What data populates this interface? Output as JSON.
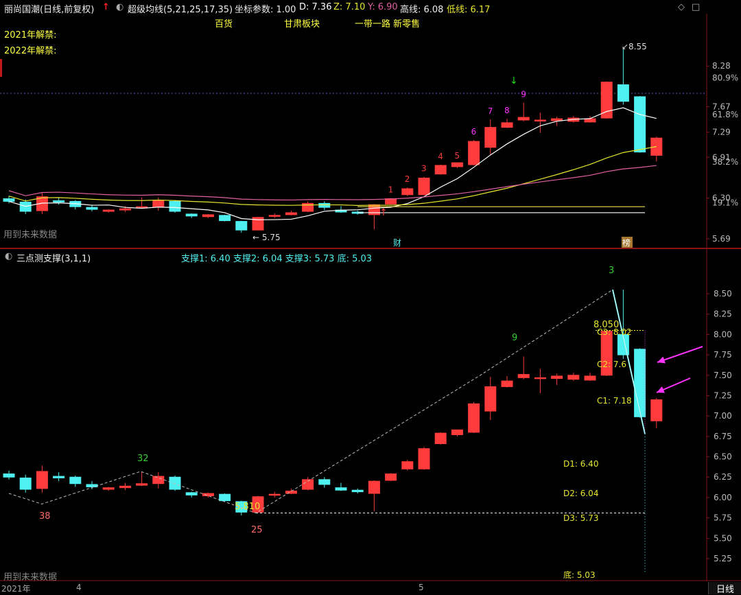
{
  "header": {
    "stock_title": "丽尚国潮(日线,前复权)",
    "up_arrow_icon": "red-up-arrow",
    "indicator_name": "超级均线(5,21,25,17,35)",
    "coord_param_label": "坐标参数: 1.00",
    "d_label": "D: 7.36",
    "z_label": "Z: 7.10",
    "y_label": "Y: 6.90",
    "high_line_label": "高线: 6.08",
    "low_line_label": "低线: 6.17",
    "concept_tags": [
      "百货",
      "甘肃板块",
      "一带一路 新零售"
    ],
    "unlock_labels": [
      "2021年解禁:",
      "2022年解禁:"
    ],
    "future_data_label": "用到未来数据"
  },
  "top_axis": {
    "ticks": [
      "8.28",
      "7.67",
      "7.29",
      "6.91",
      "6.30",
      "5.69"
    ],
    "pct": [
      "80.9%",
      "61.8%",
      "38.2%",
      "19.1%"
    ]
  },
  "top_annotations": {
    "max_label": "8.55",
    "min_label": "5.75",
    "markers_cai": "财",
    "markers_bang": "榜",
    "seq_numbers": [
      "1",
      "2",
      "3",
      "4",
      "5",
      "6",
      "7",
      "8",
      "9"
    ]
  },
  "bottom_header": {
    "indicator_name": "三点测支撑(3,1,1)",
    "support_text": "支撑1: 6.40  支撑2: 6.04  支撑3: 5.73  底: 5.03",
    "future_data_label": "用到未来数据"
  },
  "bottom_axis": {
    "ticks": [
      "8.50",
      "8.25",
      "8.00",
      "7.75",
      "7.50",
      "7.25",
      "7.00",
      "6.75",
      "6.50",
      "6.25",
      "6.00",
      "5.75",
      "5.50",
      "5.25"
    ]
  },
  "bottom_annotations": {
    "label_32": "32",
    "label_38": "38",
    "label_25": "25",
    "label_9": "9",
    "label_3": "3",
    "low_value": "5.810",
    "peak_value": "8.050",
    "c3": "C3: 8.02",
    "c2": "C2: 7.6",
    "c1": "C1: 7.18",
    "d1": "D1: 6.40",
    "d2": "D2: 6.04",
    "d3": "D3: 5.73",
    "bottom": "底: 5.03"
  },
  "footer": {
    "dates": [
      "2021年",
      "4",
      "5"
    ],
    "period_button": "日线"
  },
  "colors": {
    "up": "#ff3b3b",
    "down": "#4ff0f0",
    "ma_white": "#ffffff",
    "ma_yellow": "#e6e62e",
    "ma_pink": "#e060a0",
    "label_yellow": "#ffff40",
    "arrow_magenta": "#ff33ff"
  },
  "chart_data": {
    "type": "candlestick",
    "y_range_top": [
      5.55,
      8.72
    ],
    "y_range_bottom": [
      5.05,
      8.72
    ],
    "candles": [
      {
        "o": 6.29,
        "h": 6.33,
        "l": 6.22,
        "c": 6.25
      },
      {
        "o": 6.24,
        "h": 6.28,
        "l": 6.06,
        "c": 6.1
      },
      {
        "o": 6.11,
        "h": 6.39,
        "l": 6.06,
        "c": 6.32
      },
      {
        "o": 6.26,
        "h": 6.31,
        "l": 6.2,
        "c": 6.24
      },
      {
        "o": 6.25,
        "h": 6.27,
        "l": 6.13,
        "c": 6.17
      },
      {
        "o": 6.16,
        "h": 6.2,
        "l": 6.1,
        "c": 6.13
      },
      {
        "o": 6.1,
        "h": 6.13,
        "l": 6.08,
        "c": 6.12
      },
      {
        "o": 6.12,
        "h": 6.18,
        "l": 6.09,
        "c": 6.14
      },
      {
        "o": 6.15,
        "h": 6.31,
        "l": 6.14,
        "c": 6.17
      },
      {
        "o": 6.17,
        "h": 6.31,
        "l": 6.11,
        "c": 6.26
      },
      {
        "o": 6.25,
        "h": 6.27,
        "l": 6.08,
        "c": 6.1
      },
      {
        "o": 6.06,
        "h": 6.07,
        "l": 6.0,
        "c": 6.03
      },
      {
        "o": 6.02,
        "h": 6.06,
        "l": 6.0,
        "c": 6.05
      },
      {
        "o": 6.04,
        "h": 6.05,
        "l": 5.95,
        "c": 5.96
      },
      {
        "o": 5.95,
        "h": 5.96,
        "l": 5.78,
        "c": 5.82
      },
      {
        "o": 5.82,
        "h": 6.02,
        "l": 5.81,
        "c": 6.01
      },
      {
        "o": 6.03,
        "h": 6.07,
        "l": 6.0,
        "c": 6.04
      },
      {
        "o": 6.05,
        "h": 6.11,
        "l": 6.04,
        "c": 6.08
      },
      {
        "o": 6.1,
        "h": 6.25,
        "l": 6.09,
        "c": 6.22
      },
      {
        "o": 6.22,
        "h": 6.25,
        "l": 6.12,
        "c": 6.16
      },
      {
        "o": 6.12,
        "h": 6.18,
        "l": 6.08,
        "c": 6.09
      },
      {
        "o": 6.09,
        "h": 6.11,
        "l": 6.05,
        "c": 6.07
      },
      {
        "o": 6.05,
        "h": 6.21,
        "l": 5.83,
        "c": 6.2
      },
      {
        "o": 6.21,
        "h": 6.3,
        "l": 6.2,
        "c": 6.29
      },
      {
        "o": 6.35,
        "h": 6.46,
        "l": 6.33,
        "c": 6.44
      },
      {
        "o": 6.35,
        "h": 6.62,
        "l": 6.34,
        "c": 6.6
      },
      {
        "o": 6.66,
        "h": 6.8,
        "l": 6.65,
        "c": 6.79
      },
      {
        "o": 6.77,
        "h": 6.81,
        "l": 6.75,
        "c": 6.83
      },
      {
        "o": 6.8,
        "h": 7.17,
        "l": 6.79,
        "c": 7.15
      },
      {
        "o": 7.06,
        "h": 7.48,
        "l": 6.95,
        "c": 7.36
      },
      {
        "o": 7.36,
        "h": 7.49,
        "l": 7.35,
        "c": 7.43
      },
      {
        "o": 7.47,
        "h": 7.73,
        "l": 7.45,
        "c": 7.51
      },
      {
        "o": 7.46,
        "h": 7.58,
        "l": 7.28,
        "c": 7.47
      },
      {
        "o": 7.46,
        "h": 7.52,
        "l": 7.38,
        "c": 7.49
      },
      {
        "o": 7.45,
        "h": 7.53,
        "l": 7.43,
        "c": 7.5
      },
      {
        "o": 7.44,
        "h": 7.53,
        "l": 7.43,
        "c": 7.49
      },
      {
        "o": 7.5,
        "h": 8.05,
        "l": 7.49,
        "c": 8.04
      },
      {
        "o": 8.0,
        "h": 8.55,
        "l": 7.7,
        "c": 7.75
      },
      {
        "o": 7.82,
        "h": 7.83,
        "l": 6.98,
        "c": 6.99
      },
      {
        "o": 6.94,
        "h": 7.22,
        "l": 6.85,
        "c": 7.2
      }
    ]
  }
}
